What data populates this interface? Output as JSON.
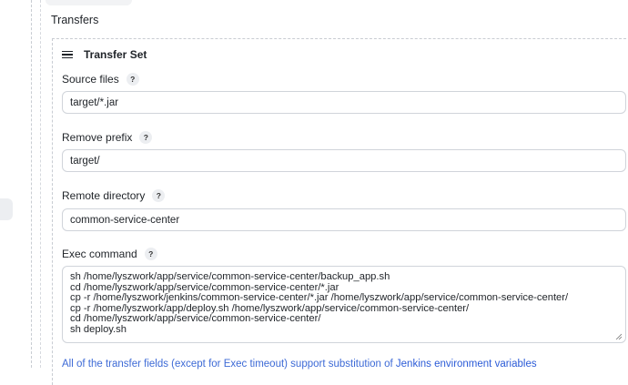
{
  "section": {
    "title": "Transfers"
  },
  "transfer_set": {
    "title": "Transfer Set",
    "source_files": {
      "label": "Source files",
      "value": "target/*.jar"
    },
    "remove_prefix": {
      "label": "Remove prefix",
      "value": "target/"
    },
    "remote_directory": {
      "label": "Remote directory",
      "value": "common-service-center"
    },
    "exec_command": {
      "label": "Exec command",
      "lines": [
        "sh /home/lyszwork/app/service/common-service-center/backup_app.sh",
        "cd /home/lyszwork/app/service/common-service-center/*.jar",
        "cp -r /home/lyszwork/jenkins/common-service-center/*.jar /home/lyszwork/app/service/common-service-center/",
        "cp -r /home/lyszwork/app/deploy.sh /home/lyszwork/app/service/common-service-center/",
        "cd /home/lyszwork/app/service/common-service-center/",
        "sh deploy.sh"
      ]
    },
    "help_symbol": "?"
  },
  "footnote": {
    "text": "All of the transfer fields (except for Exec timeout) support substitution of ",
    "link": "Jenkins environment variables"
  }
}
